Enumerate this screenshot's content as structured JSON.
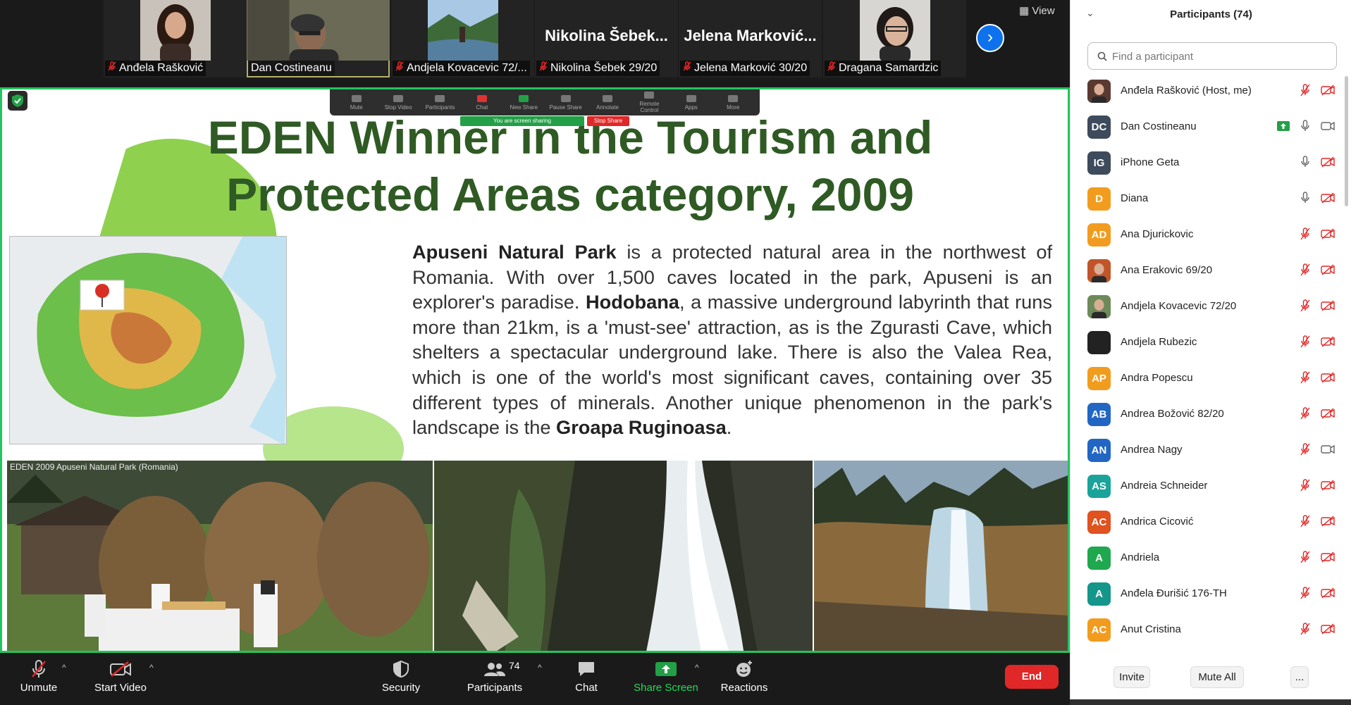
{
  "top_strip": {
    "tiles": [
      {
        "caption": "Anđela Rašković",
        "muted": true,
        "photo": "woman-dark-hair"
      },
      {
        "caption": "Dan Costineanu",
        "muted": false,
        "photo": "man-glasses",
        "active": true
      },
      {
        "caption": "Andjela Kovacevic 72/...",
        "muted": true,
        "photo": "landscape-river"
      },
      {
        "caption": "Nikolina Šebek 29/20",
        "muted": true,
        "name_display": "Nikolina  Šebek..."
      },
      {
        "caption": "Jelena Marković 30/20",
        "muted": true,
        "name_display": "Jelena  Marković..."
      },
      {
        "caption": "Dragana Samardzic",
        "muted": true,
        "photo": "woman-glasses"
      }
    ],
    "next_icon": "chevron-right-icon",
    "view_label": "View"
  },
  "share": {
    "mini_toolbar": [
      "Mute",
      "Stop Video",
      "Participants",
      "Chat",
      "New Share",
      "Pause Share",
      "Annotate",
      "Remote Control",
      "Apps",
      "More"
    ],
    "banner_green": "You are screen sharing",
    "banner_red": "Stop Share",
    "slide": {
      "title_line1": "EDEN Winner in the Tourism and",
      "title_line2": "Protected Areas category, 2009",
      "text": {
        "p1_bold": "Apuseni Natural Park",
        "p1": " is a protected natural area in the northwest of Romania. With over 1,500 caves located in the park, Apuseni is an explorer's paradise. ",
        "p2_bold": "Hodobana",
        "p2": ", a massive underground labyrinth that runs more than 21km, is a 'must-see' attraction, as is the Zgurasti Cave, which shelters a spectacular underground lake. There is also the Valea Rea, which is one of the world's most significant caves, containing over 35 different types of minerals. Another unique phenomenon in the park's landscape is the ",
        "p3_bold": "Groapa Ruginoasa",
        "p3": "."
      },
      "photo_caption": "EDEN 2009 Apuseni Natural Park (Romania)"
    }
  },
  "toolbar": {
    "unmute": "Unmute",
    "start_video": "Start Video",
    "security": "Security",
    "participants": "Participants",
    "participants_count": "74",
    "chat": "Chat",
    "share_screen": "Share Screen",
    "reactions": "Reactions",
    "end": "End",
    "share_color": "#23d959"
  },
  "panel": {
    "title": "Participants (74)",
    "search_placeholder": "Find a participant",
    "participants": [
      {
        "name": "Anđela Rašković (Host, me)",
        "initials": "",
        "color": "#5a3a30",
        "photo": true,
        "mic": "muted",
        "video": "off"
      },
      {
        "name": "Dan Costineanu",
        "initials": "DC",
        "color": "#3d4b5c",
        "mic": "on",
        "video": "on",
        "sharing": true
      },
      {
        "name": "iPhone Geta",
        "initials": "IG",
        "color": "#3d4b5c",
        "mic": "on",
        "video": "off"
      },
      {
        "name": "Diana",
        "initials": "D",
        "color": "#f29c1f",
        "mic": "on",
        "video": "off"
      },
      {
        "name": "Ana Djurickovic",
        "initials": "AD",
        "color": "#f29c1f",
        "mic": "muted",
        "video": "off"
      },
      {
        "name": "Ana Erakovic 69/20",
        "initials": "",
        "color": "#c0552a",
        "photo": true,
        "mic": "muted",
        "video": "off"
      },
      {
        "name": "Andjela Kovacevic 72/20",
        "initials": "",
        "color": "#6d8a5a",
        "photo": true,
        "mic": "muted",
        "video": "off"
      },
      {
        "name": "Andjela Rubezic",
        "initials": "",
        "color": "#222222",
        "mic": "muted",
        "video": "off"
      },
      {
        "name": "Andra Popescu",
        "initials": "AP",
        "color": "#f29c1f",
        "mic": "muted",
        "video": "off"
      },
      {
        "name": "Andrea Božović 82/20",
        "initials": "AB",
        "color": "#2266c4",
        "mic": "muted",
        "video": "off"
      },
      {
        "name": "Andrea Nagy",
        "initials": "AN",
        "color": "#2266c4",
        "mic": "muted",
        "video": "on"
      },
      {
        "name": "Andreia Schneider",
        "initials": "AS",
        "color": "#1aa39a",
        "mic": "muted",
        "video": "off"
      },
      {
        "name": "Andrica Cicović",
        "initials": "AC",
        "color": "#e0521f",
        "mic": "muted",
        "video": "off"
      },
      {
        "name": "Andriela",
        "initials": "A",
        "color": "#1fa84d",
        "mic": "muted",
        "video": "off"
      },
      {
        "name": "Anđela Đurišić 176-TH",
        "initials": "A",
        "color": "#14968a",
        "mic": "muted",
        "video": "off"
      },
      {
        "name": "Anut Cristina",
        "initials": "AC",
        "color": "#f29c1f",
        "mic": "muted",
        "video": "off"
      }
    ],
    "invite": "Invite",
    "mute_all": "Mute All",
    "more": "..."
  }
}
